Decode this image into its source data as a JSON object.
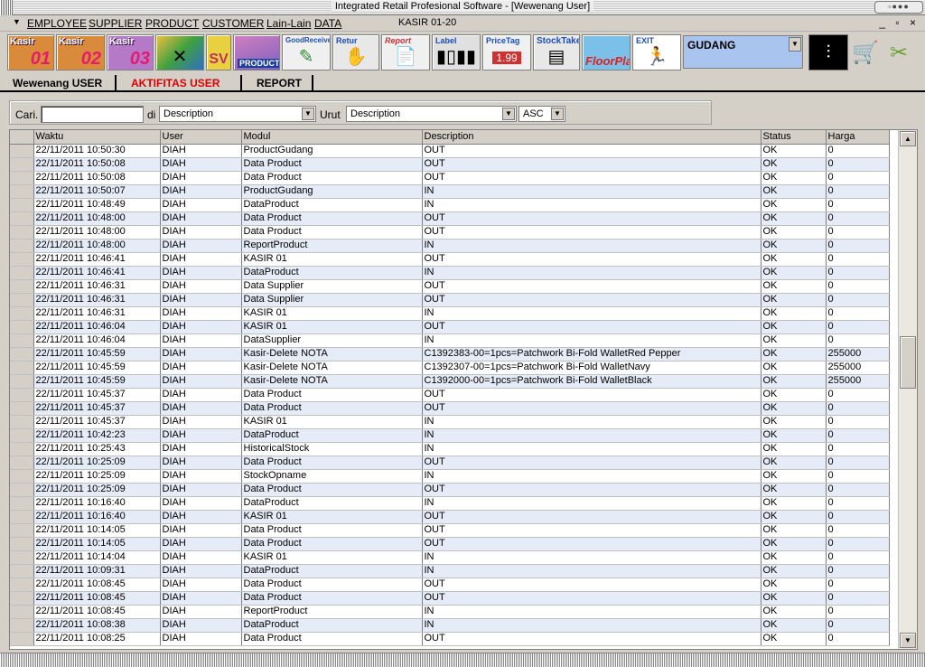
{
  "window": {
    "title": "Integrated Retail Profesional Software - [Wewenang User]"
  },
  "menu": {
    "items": [
      "EMPLOYEE",
      "SUPPLIER",
      "PRODUCT",
      "CUSTOMER",
      "Lain-Lain",
      "DATA"
    ],
    "kasir": "KASIR 01-20",
    "window_controls": "_ ▫ ×"
  },
  "toolbar": {
    "kasir1": {
      "label": "Kasir",
      "num": "01"
    },
    "kasir2": {
      "label": "Kasir",
      "num": "02"
    },
    "kasir3": {
      "label": "Kasir",
      "num": "03"
    },
    "sv": "SV",
    "product": "PRODUCT",
    "goodreceived": "GoodReceived",
    "retur": "Retur",
    "report": "Report",
    "label": "Label",
    "pricetag": "PriceTag",
    "pricetag_price": "1.99",
    "stocktake": "StockTake",
    "floorplan": "FloorPlan",
    "exit": "EXIT",
    "warehouse": "GUDANG"
  },
  "tabs": [
    "Wewenang USER",
    "AKTIFITAS USER",
    "REPORT"
  ],
  "filter": {
    "cari_label": "Cari.",
    "cari_value": "",
    "di_label": "di",
    "di_value": "Description",
    "urut_label": "Urut",
    "urut_value": "Description",
    "order_value": "ASC"
  },
  "grid": {
    "columns": [
      "Waktu",
      "User",
      "Modul",
      "Description",
      "Status",
      "Harga"
    ],
    "rows": [
      [
        "22/11/2011 10:50:30",
        "DIAH",
        "ProductGudang",
        "OUT",
        "OK",
        "0"
      ],
      [
        "22/11/2011 10:50:08",
        "DIAH",
        "Data Product",
        "OUT",
        "OK",
        "0"
      ],
      [
        "22/11/2011 10:50:08",
        "DIAH",
        "Data Product",
        "OUT",
        "OK",
        "0"
      ],
      [
        "22/11/2011 10:50:07",
        "DIAH",
        "ProductGudang",
        "IN",
        "OK",
        "0"
      ],
      [
        "22/11/2011 10:48:49",
        "DIAH",
        "DataProduct",
        "IN",
        "OK",
        "0"
      ],
      [
        "22/11/2011 10:48:00",
        "DIAH",
        "Data Product",
        "OUT",
        "OK",
        "0"
      ],
      [
        "22/11/2011 10:48:00",
        "DIAH",
        "Data Product",
        "OUT",
        "OK",
        "0"
      ],
      [
        "22/11/2011 10:48:00",
        "DIAH",
        "ReportProduct",
        "IN",
        "OK",
        "0"
      ],
      [
        "22/11/2011 10:46:41",
        "DIAH",
        "KASIR 01",
        "OUT",
        "OK",
        "0"
      ],
      [
        "22/11/2011 10:46:41",
        "DIAH",
        "DataProduct",
        "IN",
        "OK",
        "0"
      ],
      [
        "22/11/2011 10:46:31",
        "DIAH",
        "Data Supplier",
        "OUT",
        "OK",
        "0"
      ],
      [
        "22/11/2011 10:46:31",
        "DIAH",
        "Data Supplier",
        "OUT",
        "OK",
        "0"
      ],
      [
        "22/11/2011 10:46:31",
        "DIAH",
        "KASIR 01",
        "IN",
        "OK",
        "0"
      ],
      [
        "22/11/2011 10:46:04",
        "DIAH",
        "KASIR 01",
        "OUT",
        "OK",
        "0"
      ],
      [
        "22/11/2011 10:46:04",
        "DIAH",
        "DataSupplier",
        "IN",
        "OK",
        "0"
      ],
      [
        "22/11/2011 10:45:59",
        "DIAH",
        "Kasir-Delete NOTA",
        "C1392383-00=1pcs=Patchwork Bi-Fold WalletRed Pepper",
        "OK",
        "255000"
      ],
      [
        "22/11/2011 10:45:59",
        "DIAH",
        "Kasir-Delete NOTA",
        "C1392307-00=1pcs=Patchwork Bi-Fold WalletNavy",
        "OK",
        "255000"
      ],
      [
        "22/11/2011 10:45:59",
        "DIAH",
        "Kasir-Delete NOTA",
        "C1392000-00=1pcs=Patchwork Bi-Fold WalletBlack",
        "OK",
        "255000"
      ],
      [
        "22/11/2011 10:45:37",
        "DIAH",
        "Data Product",
        "OUT",
        "OK",
        "0"
      ],
      [
        "22/11/2011 10:45:37",
        "DIAH",
        "Data Product",
        "OUT",
        "OK",
        "0"
      ],
      [
        "22/11/2011 10:45:37",
        "DIAH",
        "KASIR 01",
        "IN",
        "OK",
        "0"
      ],
      [
        "22/11/2011 10:42:23",
        "DIAH",
        "DataProduct",
        "IN",
        "OK",
        "0"
      ],
      [
        "22/11/2011 10:25:43",
        "DIAH",
        "HistoricalStock",
        "IN",
        "OK",
        "0"
      ],
      [
        "22/11/2011 10:25:09",
        "DIAH",
        "Data Product",
        "OUT",
        "OK",
        "0"
      ],
      [
        "22/11/2011 10:25:09",
        "DIAH",
        "StockOpname",
        "IN",
        "OK",
        "0"
      ],
      [
        "22/11/2011 10:25:09",
        "DIAH",
        "Data Product",
        "OUT",
        "OK",
        "0"
      ],
      [
        "22/11/2011 10:16:40",
        "DIAH",
        "DataProduct",
        "IN",
        "OK",
        "0"
      ],
      [
        "22/11/2011 10:16:40",
        "DIAH",
        "KASIR 01",
        "OUT",
        "OK",
        "0"
      ],
      [
        "22/11/2011 10:14:05",
        "DIAH",
        "Data Product",
        "OUT",
        "OK",
        "0"
      ],
      [
        "22/11/2011 10:14:05",
        "DIAH",
        "Data Product",
        "OUT",
        "OK",
        "0"
      ],
      [
        "22/11/2011 10:14:04",
        "DIAH",
        "KASIR 01",
        "IN",
        "OK",
        "0"
      ],
      [
        "22/11/2011 10:09:31",
        "DIAH",
        "DataProduct",
        "IN",
        "OK",
        "0"
      ],
      [
        "22/11/2011 10:08:45",
        "DIAH",
        "Data Product",
        "OUT",
        "OK",
        "0"
      ],
      [
        "22/11/2011 10:08:45",
        "DIAH",
        "Data Product",
        "OUT",
        "OK",
        "0"
      ],
      [
        "22/11/2011 10:08:45",
        "DIAH",
        "ReportProduct",
        "IN",
        "OK",
        "0"
      ],
      [
        "22/11/2011 10:08:38",
        "DIAH",
        "DataProduct",
        "IN",
        "OK",
        "0"
      ],
      [
        "22/11/2011 10:08:25",
        "DIAH",
        "Data Product",
        "OUT",
        "OK",
        "0"
      ]
    ]
  },
  "colors": {
    "grid_alt_row": "#e6ecf7",
    "warehouse_bg": "#aac4f0",
    "tab_active_red": "#e00000"
  }
}
